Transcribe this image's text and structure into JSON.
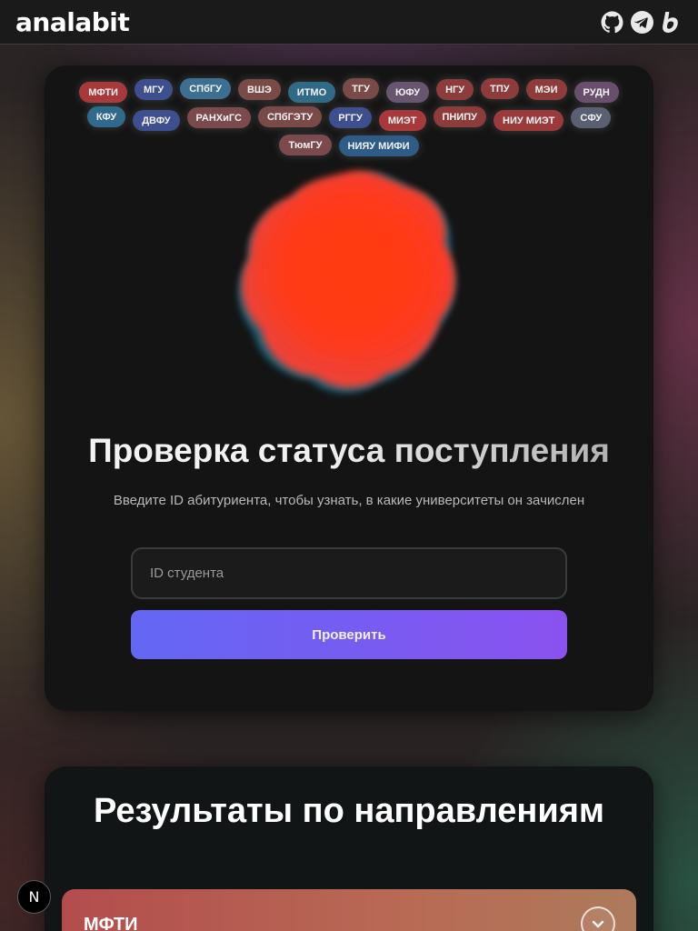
{
  "header": {
    "logo": "analabit",
    "icons": [
      "github-icon",
      "telegram-icon",
      "brand-b-icon"
    ]
  },
  "universities": [
    {
      "name": "МФТИ",
      "color": "#a8393b"
    },
    {
      "name": "МГУ",
      "color": "#3d4f8e"
    },
    {
      "name": "СПбГУ",
      "color": "#3d6f92"
    },
    {
      "name": "ВШЭ",
      "color": "#7a4a49"
    },
    {
      "name": "ИТМО",
      "color": "#2f6a86"
    },
    {
      "name": "ТГУ",
      "color": "#7a4a49"
    },
    {
      "name": "ЮФУ",
      "color": "#68556f"
    },
    {
      "name": "НГУ",
      "color": "#8e3b3b"
    },
    {
      "name": "ТПУ",
      "color": "#8e3b3b"
    },
    {
      "name": "МЭИ",
      "color": "#8e3b3b"
    },
    {
      "name": "РУДН",
      "color": "#6a4f6d"
    },
    {
      "name": "КФУ",
      "color": "#2f6a8c"
    },
    {
      "name": "ДВФУ",
      "color": "#3d4f8e"
    },
    {
      "name": "РАНХиГС",
      "color": "#7a4a4c"
    },
    {
      "name": "СПбГЭТУ",
      "color": "#7a4a49"
    },
    {
      "name": "РГГУ",
      "color": "#3d4f8e"
    },
    {
      "name": "МИЭТ",
      "color": "#a8393b"
    },
    {
      "name": "ПНИПУ",
      "color": "#8e3b3b"
    },
    {
      "name": "НИУ МИЭТ",
      "color": "#9a3a3a"
    },
    {
      "name": "СФУ",
      "color": "#5a5f72"
    },
    {
      "name": "ТюмГУ",
      "color": "#7a4a4c"
    },
    {
      "name": "НИЯУ МИФИ",
      "color": "#2f5c86"
    }
  ],
  "hero": {
    "title": "Проверка статуса поступления",
    "subtitle": "Введите ID абитуриента, чтобы узнать, в какие университеты он зачислен",
    "input_placeholder": "ID студента",
    "input_value": "",
    "button_label": "Проверить"
  },
  "results": {
    "title": "Результаты по направлениям",
    "items": [
      {
        "name": "МФТИ",
        "expanded": false
      }
    ]
  },
  "dev_badge": "N",
  "colors": {
    "accent_start": "#6367f4",
    "accent_end": "#8a52ef",
    "blob": "#ff3b14",
    "blob_shadow": "#1e8aa6"
  }
}
